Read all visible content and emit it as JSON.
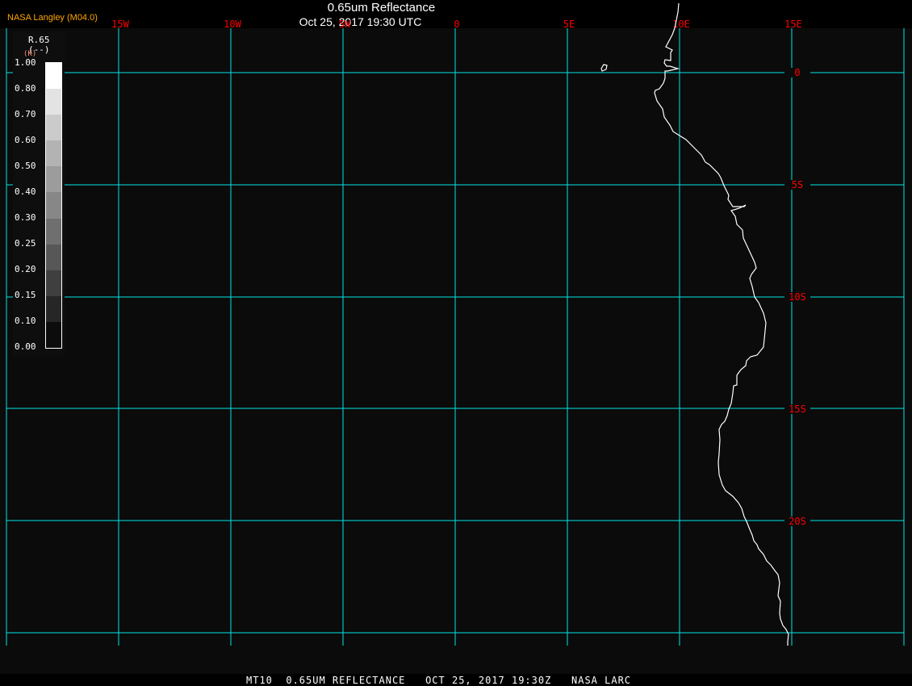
{
  "header": {
    "title": "0.65um Reflectance",
    "subtitle": "Oct 25, 2017 19:30 UTC",
    "producer": "NASA Langley (M04.0)"
  },
  "map": {
    "projection_grid_interval_deg": 5,
    "lon_labels": [
      "15W",
      "10W",
      "5W",
      "0",
      "5E",
      "10E",
      "15E"
    ],
    "lat_labels": [
      "0",
      "5S",
      "10S",
      "15S",
      "20S"
    ],
    "colors": {
      "grid": "#00e5e5",
      "grid_label": "#ff0000",
      "coastline": "#ffffff",
      "background": "#0b0b0b"
    }
  },
  "legend": {
    "variable": "R.65",
    "units": "(--)",
    "units_alt": "(K)",
    "ticks": [
      "1.00",
      "0.80",
      "0.70",
      "0.60",
      "0.50",
      "0.40",
      "0.30",
      "0.25",
      "0.20",
      "0.15",
      "0.10",
      "0.00"
    ],
    "band_colors": [
      "#ffffff",
      "#e3e3e3",
      "#cbcbcb",
      "#b3b3b3",
      "#9c9c9c",
      "#878787",
      "#6f6f6f",
      "#575757",
      "#3f3f3f",
      "#262626",
      "#0c0c0c"
    ]
  },
  "footer": {
    "text": "MT10  0.65UM REFLECTANCE   OCT 25, 2017 19:30Z   NASA LARC"
  }
}
